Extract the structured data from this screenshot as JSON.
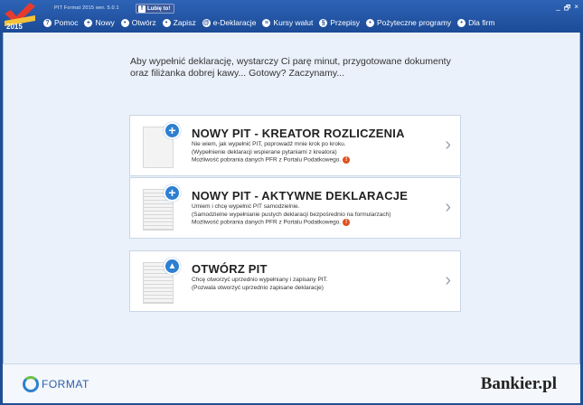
{
  "titlebar": {
    "app_title": "PIT Format 2015 wer. 5.0.1",
    "logo_year": "2015",
    "like_label": "Lubię to!",
    "win_controls": [
      "_",
      "🗗",
      "×"
    ]
  },
  "menu": [
    {
      "icon": "?",
      "label": "Pomoc"
    },
    {
      "icon": "+",
      "label": "Nowy"
    },
    {
      "icon": "•",
      "label": "Otwórz"
    },
    {
      "icon": "•",
      "label": "Zapisz"
    },
    {
      "icon": "@",
      "label": "e-Deklaracje"
    },
    {
      "icon": "≡",
      "label": "Kursy walut"
    },
    {
      "icon": "§",
      "label": "Przepisy"
    },
    {
      "icon": "•",
      "label": "Pożyteczne programy"
    },
    {
      "icon": "•",
      "label": "Dla firm"
    }
  ],
  "intro": {
    "line1": "Aby wypełnić deklarację, wystarczy Ci parę minut, przygotowane dokumenty",
    "line2": "oraz filiżanka dobrej kawy... Gotowy? Zaczynamy..."
  },
  "cards": [
    {
      "title": "NOWY PIT - KREATOR ROZLICZENIA",
      "line1": "Nie wiem, jak wypełnić PIT, poprowadź mnie krok po kroku.",
      "line2": "(Wypełnienie deklaracji wspierane pytaniami z kreatora)",
      "line3": "Możliwość pobrania danych PFR z Portalu Podatkowego.",
      "badge": "+",
      "info": "!"
    },
    {
      "title": "NOWY PIT - AKTYWNE DEKLARACJE",
      "line1": "Umiem i chcę wypełnić PIT samodzielnie.",
      "line2": "(Samodzielne wypełnianie pustych deklaracji bezpośrednio na formularzach)",
      "line3": "Możliwość pobrania danych PFR z Portalu Podatkowego.",
      "badge": "+",
      "info": "!"
    },
    {
      "title": "OTWÓRZ PIT",
      "line1": "Chcę otworzyć uprzednio wypełniany i zapisany PIT.",
      "line2": "(Pozwala otworzyć uprzednio zapisane deklaracje)",
      "badge": "▲"
    }
  ],
  "chevron": "›",
  "footer": {
    "format_logo": "FORMAT",
    "bankier_logo": "Bankier.pl"
  },
  "colors": {
    "titlebar": "#1f4e93",
    "badge": "#2d7fd1",
    "info": "#e0501e"
  }
}
